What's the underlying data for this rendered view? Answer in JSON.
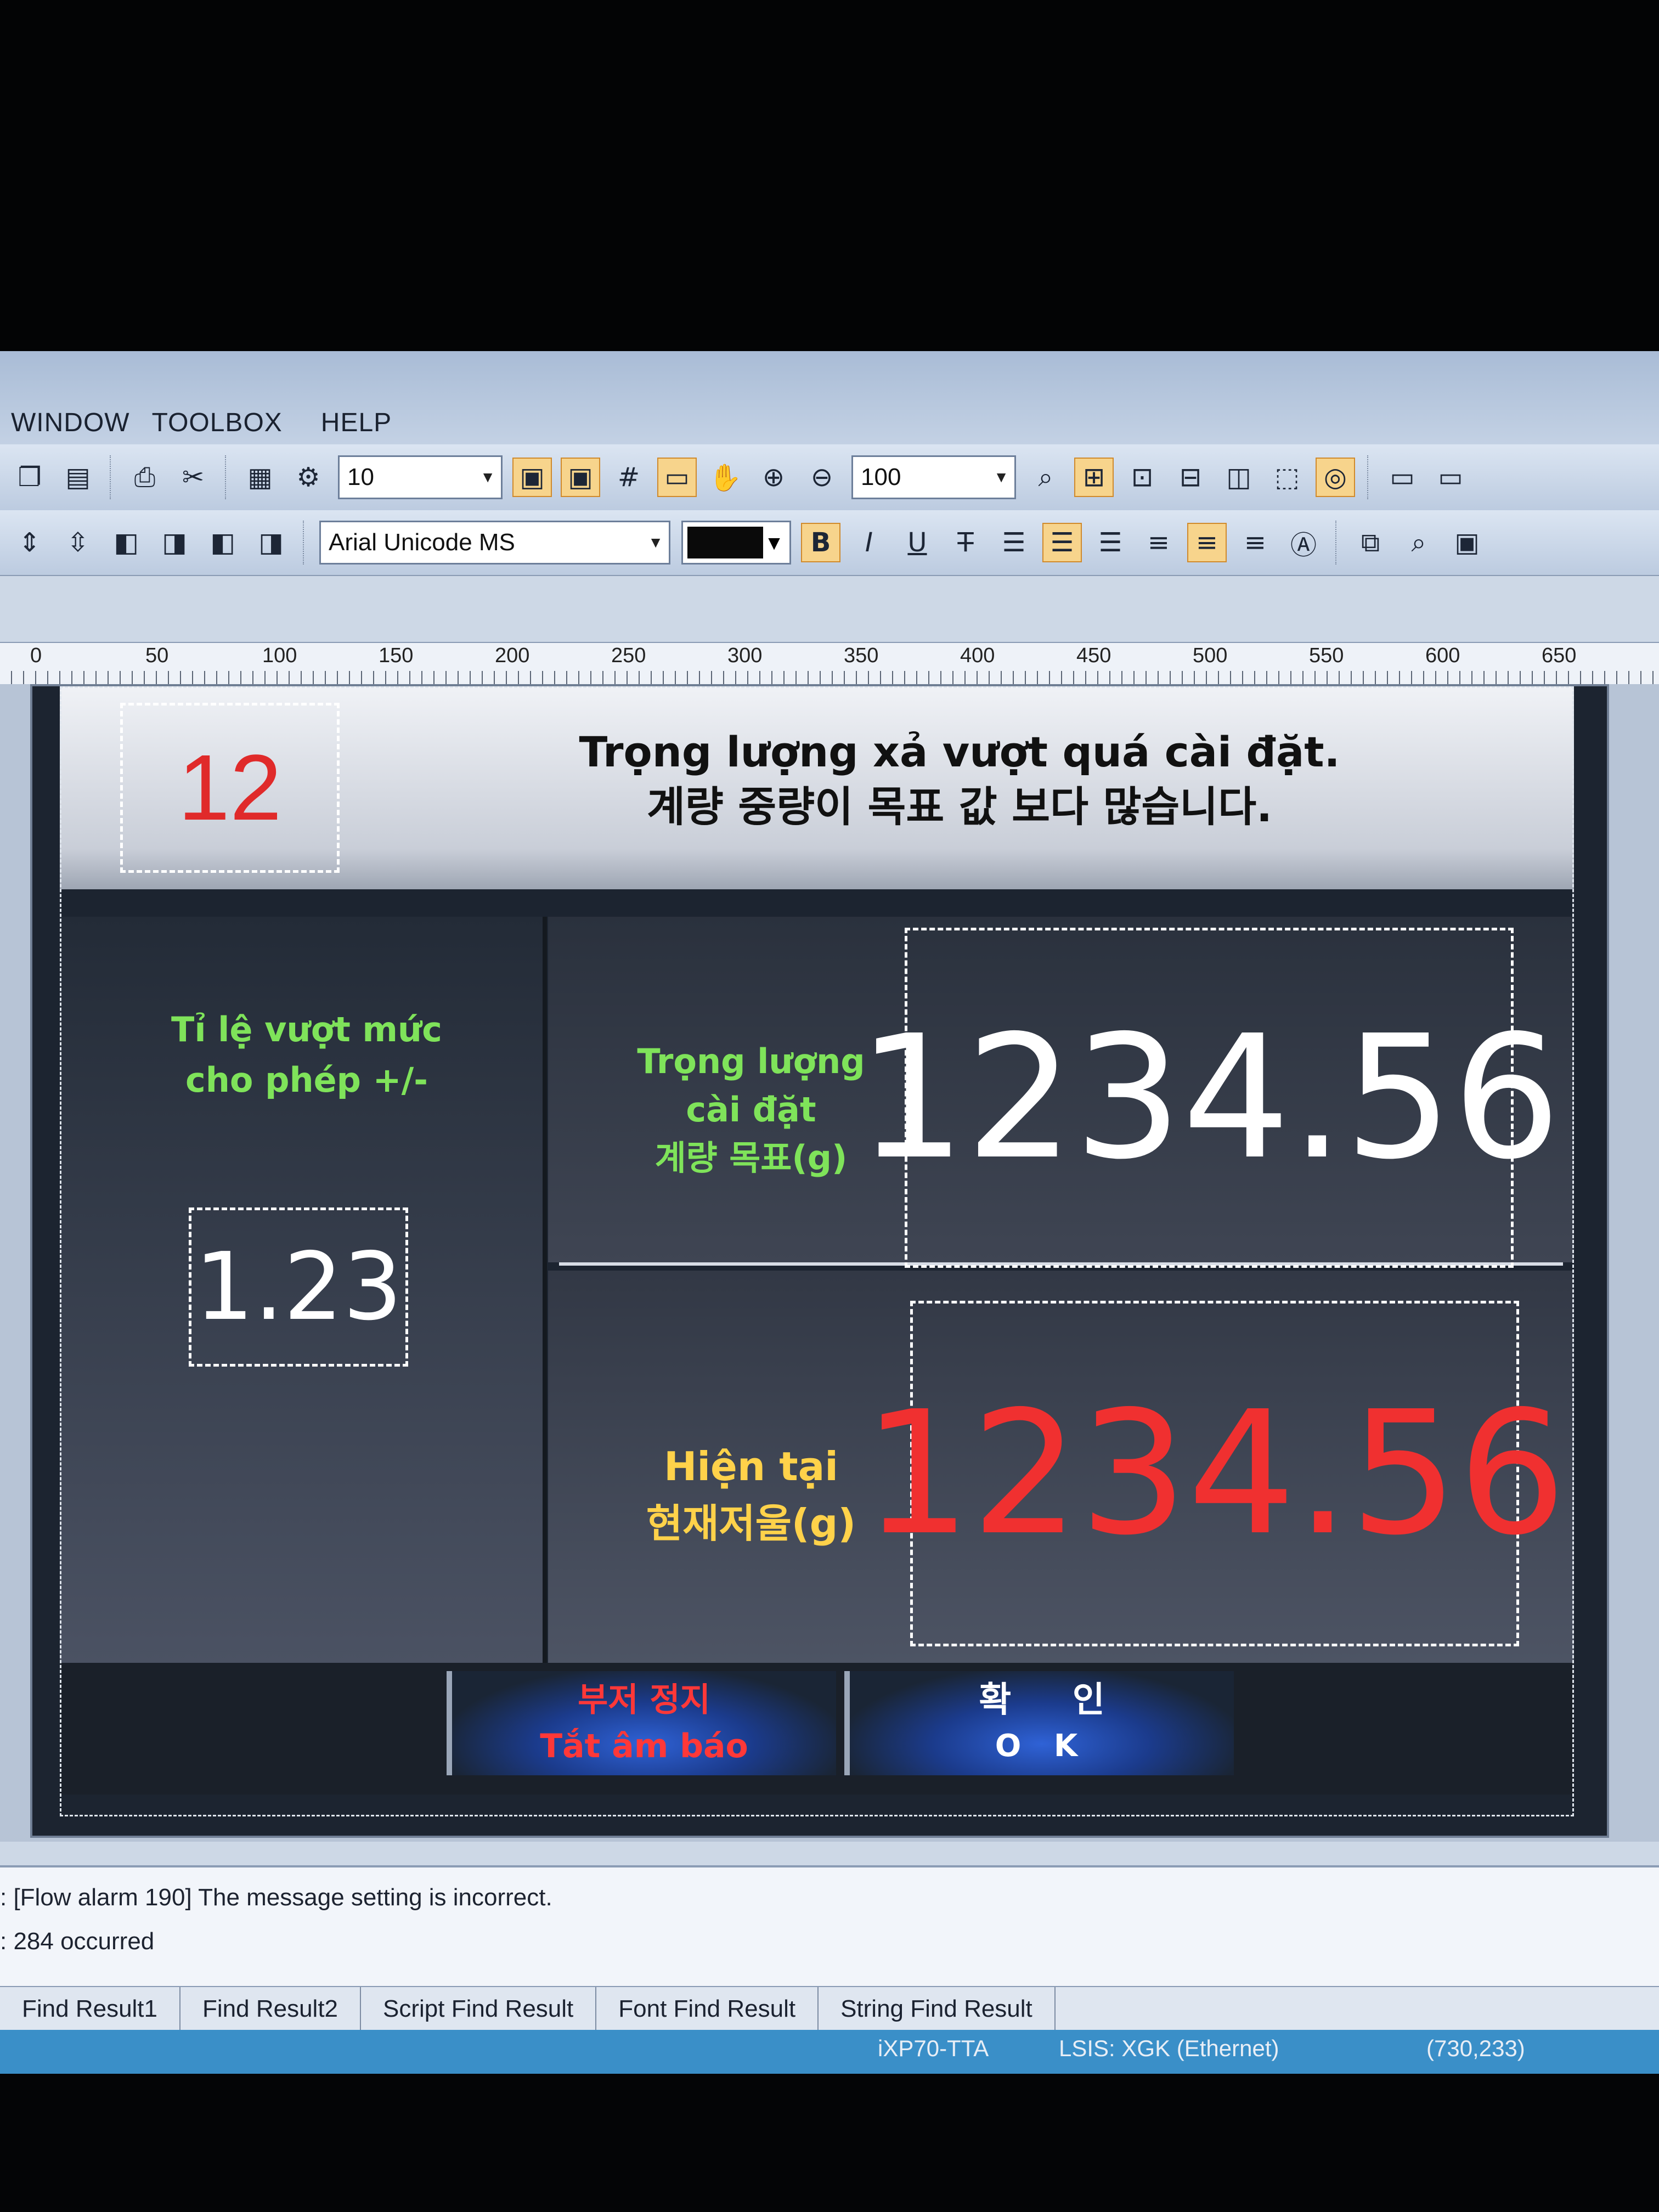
{
  "menubar": {
    "items": [
      "WINDOW",
      "TOOLBOX",
      "HELP"
    ]
  },
  "toolbar": {
    "grid_size": "10",
    "zoom": "100",
    "font_name": "Arial Unicode MS",
    "bold_label": "B",
    "italic_label": "I",
    "underline_label": "U",
    "strike_label": "T"
  },
  "ruler": {
    "labels": [
      "0",
      "50",
      "100",
      "150",
      "200",
      "250",
      "300",
      "350",
      "400",
      "450",
      "500",
      "550",
      "600",
      "650"
    ]
  },
  "screen": {
    "alarm_number": "12",
    "alarm_message_line1": "Trọng lượng xả vượt quá cài đặt.",
    "alarm_message_line2": "계량 중량이 목표 값 보다 많습니다.",
    "tolerance_label_line1": "Tỉ lệ vượt mức",
    "tolerance_label_line2": "cho phép +/-",
    "tolerance_value": "1.23",
    "target_label_line1": "Trọng lượng",
    "target_label_line2": "cài đặt",
    "target_label_line3": "계량 목표(g)",
    "target_value": "1234.56",
    "current_label_line1": "Hiện tại",
    "current_label_line2": "현재저울(g)",
    "current_value": "1234.56",
    "buzzer_button_line1": "부저 정지",
    "buzzer_button_line2": "Tắt âm báo",
    "ok_button_line1": "확     인",
    "ok_button_line2": "O K"
  },
  "output": {
    "line1": ": [Flow alarm 190] The message setting is incorrect.",
    "line2": ": 284 occurred"
  },
  "tabs": [
    "Find Result1",
    "Find Result2",
    "Script Find Result",
    "Font Find Result",
    "String Find Result"
  ],
  "statusbar": {
    "device": "iXP70-TTA",
    "plc": "LSIS: XGK (Ethernet)",
    "cursor": "(730,233)"
  },
  "colors": {
    "alarm_number": "#e02a2a",
    "green_label": "#7fe35a",
    "yellow_label": "#ffd24a",
    "current_value": "#f03030",
    "target_value": "#ffffff"
  }
}
